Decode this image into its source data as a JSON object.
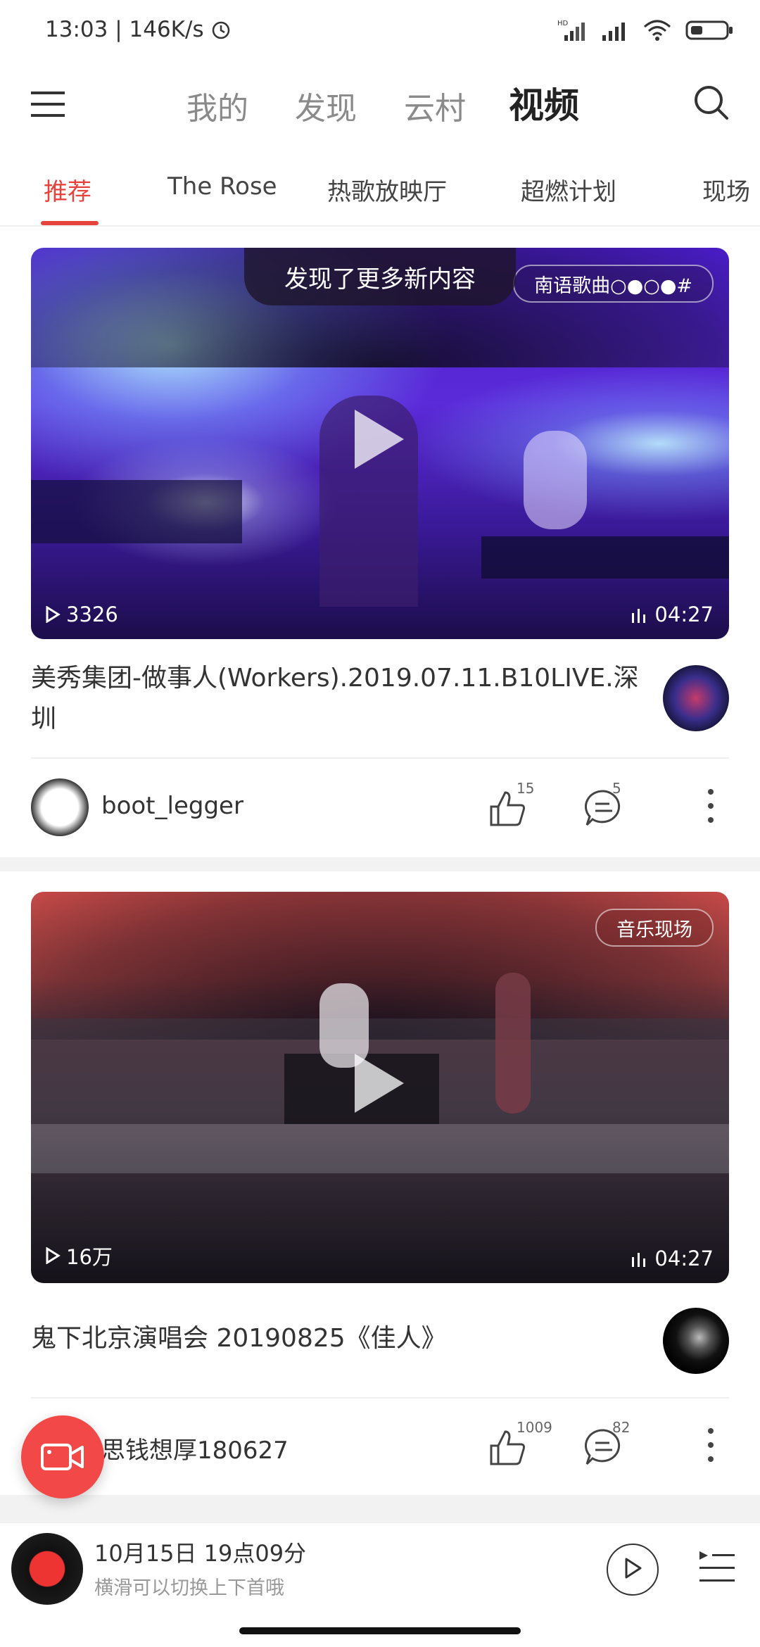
{
  "status_bar": {
    "time": "13:03",
    "net_speed": "146K/s",
    "icons": [
      "alarm-icon",
      "hd-signal-icon",
      "signal-icon",
      "wifi-icon",
      "battery-icon"
    ]
  },
  "header": {
    "tabs": [
      {
        "label": "我的",
        "active": false
      },
      {
        "label": "发现",
        "active": false
      },
      {
        "label": "云村",
        "active": false
      },
      {
        "label": "视频",
        "active": true
      }
    ],
    "menu_icon": "menu-icon",
    "search_icon": "search-icon"
  },
  "categories": [
    {
      "label": "推荐",
      "active": true
    },
    {
      "label": "The Rose",
      "active": false
    },
    {
      "label": "热歌放映厅",
      "active": false
    },
    {
      "label": "超燃计划",
      "active": false
    },
    {
      "label": "现场",
      "active": false
    }
  ],
  "toast": "发现了更多新内容",
  "videos": [
    {
      "tag": "南语歌曲○●○●#",
      "play_count": "3326",
      "duration": "04:27",
      "title": "美秀集团-做事人(Workers).2019.07.11.B10LIVE.深圳",
      "author": "boot_legger",
      "likes": "15",
      "comments": "5"
    },
    {
      "tag": "音乐现场",
      "play_count": "16万",
      "duration": "04:27",
      "title": "鬼下北京演唱会 20190825《佳人》",
      "author": "思钱想厚180627",
      "likes": "1009",
      "comments": "82"
    }
  ],
  "player": {
    "title": "10月15日 19点09分",
    "subtitle": "横滑可以切换上下首哦"
  },
  "colors": {
    "accent": "#e8423c",
    "fab": "#f24848"
  }
}
